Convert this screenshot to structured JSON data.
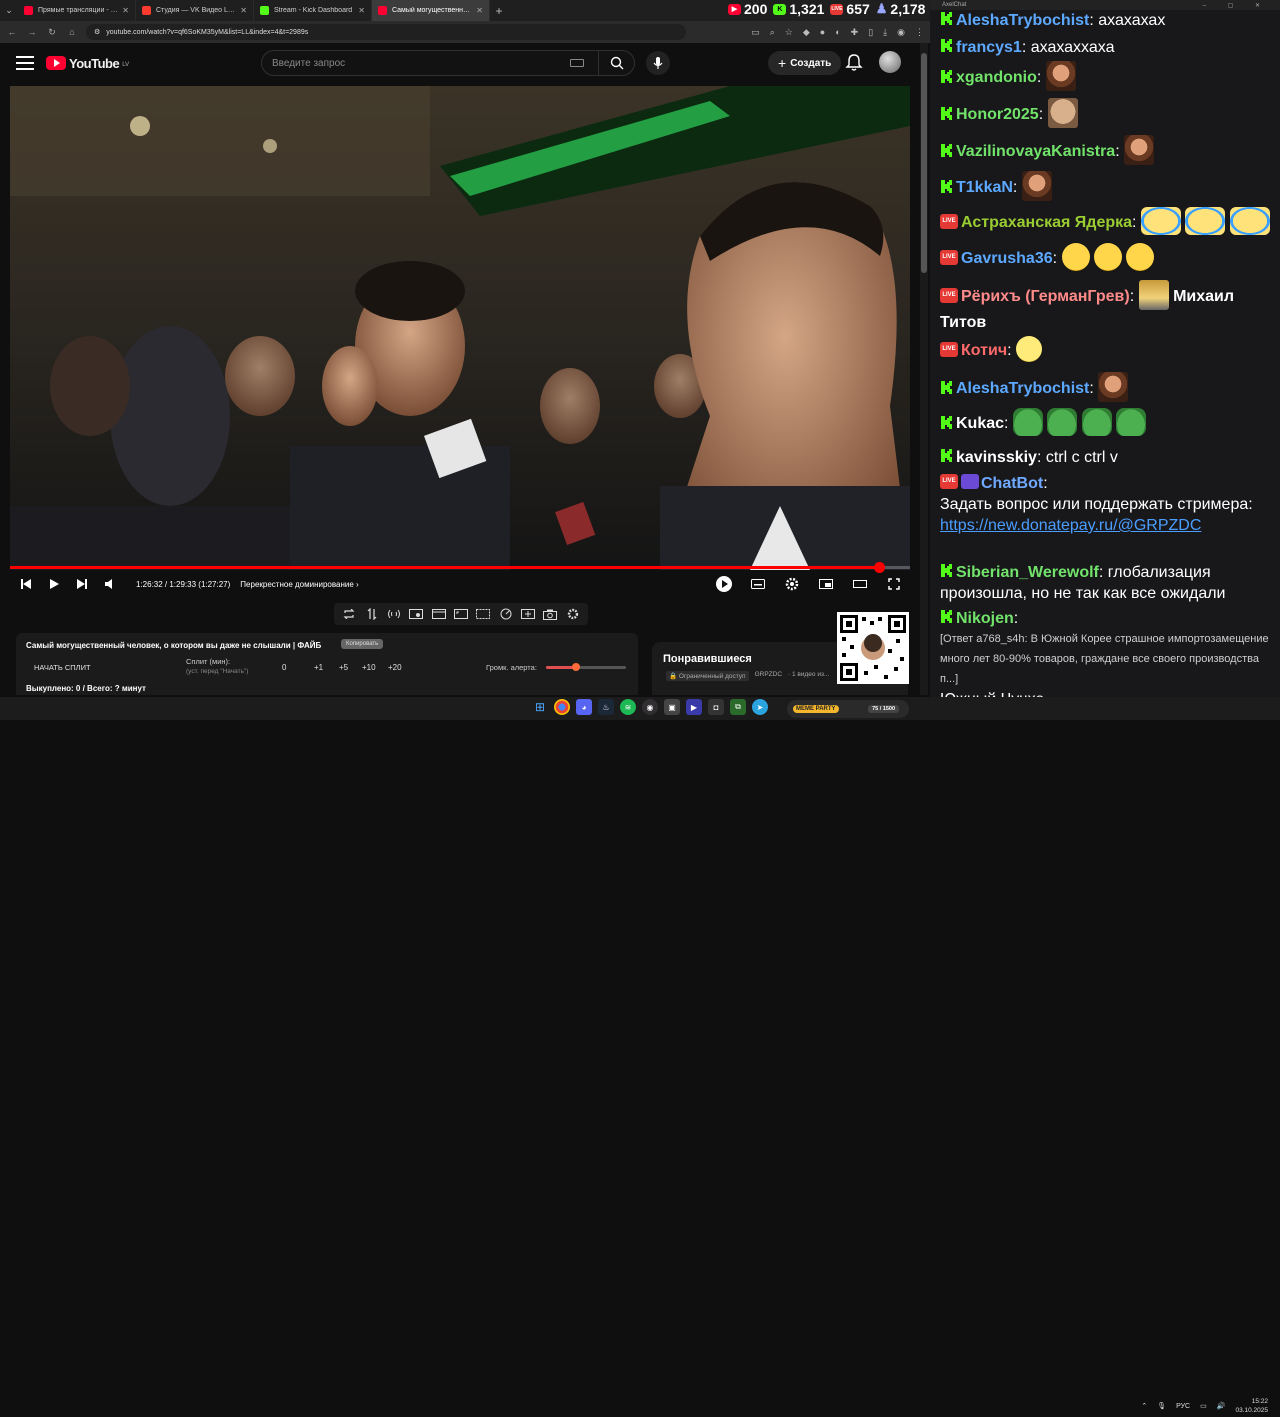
{
  "browser": {
    "tabs": [
      {
        "label": "Прямые трансляции - YouTub...",
        "color": "#ff0033",
        "active": false
      },
      {
        "label": "Студия — VK Видео Live",
        "color": "#ff3b30",
        "active": false
      },
      {
        "label": "Stream - Kick Dashboard",
        "color": "#53fc18",
        "active": false
      },
      {
        "label": "Самый могущественный чел...",
        "color": "#ff0033",
        "active": true
      }
    ],
    "url": "youtube.com/watch?v=qf6SoKM35yM&list=LL&index=4&t=2989s"
  },
  "counters": [
    {
      "platform": "youtube",
      "value": "200",
      "color": "#ff0033"
    },
    {
      "platform": "kick",
      "value": "1,321",
      "color": "#53fc18"
    },
    {
      "platform": "vk-live",
      "value": "657",
      "color": "#e53935"
    },
    {
      "platform": "total",
      "value": "2,178",
      "color": "#9aa7ff"
    }
  ],
  "youtube": {
    "logo_text": "YouTube",
    "logo_region": "LV",
    "search_placeholder": "Введите запрос",
    "create_label": "Создать"
  },
  "player": {
    "progress_fraction": 0.966,
    "time_text": "1:26:32 / 1:29:33 (1:27:27)",
    "chapter": "Перекрестное доминирование"
  },
  "split_panel": {
    "title": "Самый могущественный человек, о котором вы даже не слышали | ФАЙБ",
    "badge": "Копировать",
    "start_label": "НАЧАТЬ СПЛИТ",
    "split_label": "Сплит (мин):",
    "split_hint": "(уст. перед \"Начать\")",
    "split_value": "0",
    "steps": [
      "+1",
      "+5",
      "+10",
      "+20"
    ],
    "volume_label": "Громк. алерта:",
    "volume_fraction": 0.38,
    "bought": "Выкуплено: 0 / Всего: ? минут"
  },
  "liked": {
    "title": "Понравившиеся",
    "restricted": "Ограниченный доступ",
    "channel": "GRPZDC",
    "meta": "· 1 видео из..."
  },
  "chat": {
    "window_title": "AxelChat",
    "messages": [
      {
        "platform": "kick",
        "user": "AleshaTrybochist",
        "color": "#5da9ff",
        "text": "ахахахах",
        "emotes": []
      },
      {
        "platform": "kick",
        "user": "francys1",
        "color": "#5da9ff",
        "text": "ахахаххаха",
        "emotes": []
      },
      {
        "platform": "kick",
        "user": "xgandonio",
        "color": "#72e36a",
        "text": "",
        "emotes": [
          "face"
        ]
      },
      {
        "platform": "kick",
        "user": "Honor2025",
        "color": "#72e36a",
        "text": "",
        "emotes": [
          "honor"
        ]
      },
      {
        "platform": "kick",
        "user": "VazilinovayaKanistra",
        "color": "#72e36a",
        "text": "",
        "emotes": [
          "face"
        ]
      },
      {
        "platform": "kick",
        "user": "T1kkaN",
        "color": "#5da9ff",
        "text": "",
        "emotes": [
          "face"
        ]
      },
      {
        "platform": "vk",
        "user": "Астраханская Ядерка",
        "color": "#9acd32",
        "text": "",
        "emotes": [
          "cry",
          "cry",
          "cry"
        ]
      },
      {
        "platform": "vk",
        "user": "Gavrusha36",
        "color": "#5da9ff",
        "text": "",
        "emotes": [
          "laugh",
          "laugh",
          "laugh"
        ]
      },
      {
        "platform": "vk",
        "user": "Рёрихъ (ГерманГрев)",
        "color": "#ff8a8a",
        "text": "Михаил Титов",
        "emotes": [
          "fig"
        ]
      },
      {
        "platform": "vk",
        "user": "Котич",
        "color": "#ff6a6a",
        "text": "",
        "emotes": [
          "smile"
        ]
      },
      {
        "platform": "kick",
        "user": "AleshaTrybochist",
        "color": "#5da9ff",
        "text": "",
        "emotes": [
          "face"
        ]
      },
      {
        "platform": "kick",
        "user": "Kukac",
        "color": "#ffffff",
        "text": "",
        "emotes": [
          "frog",
          "frog",
          "frog",
          "frog"
        ]
      },
      {
        "platform": "kick",
        "user": "kavinsskiy",
        "color": "#ffffff",
        "text": "ctrl c ctrl v",
        "emotes": []
      },
      {
        "platform": "vk",
        "user": "ChatBot",
        "color": "#6fa8ff",
        "text": "Задать вопрос или поддержать стримера:",
        "link": "https://new.donatepay.ru/@GRPZDC",
        "emotes": []
      },
      {
        "platform": "kick",
        "user": "Siberian_Werewolf",
        "color": "#72e36a",
        "text": "глобализация произошла, но не так как все ожидали",
        "emotes": []
      },
      {
        "platform": "kick",
        "user": "Nikojen",
        "color": "#72e36a",
        "text": "[Ответ a768_s4h: В Южной Корее страшное импортозамещение много лет 80-90% товаров, граждане все своего производства п...]",
        "text2": "Южный Чучхе",
        "emotes": []
      }
    ]
  },
  "taskbar": {
    "meme_label": "MEME PARTY",
    "meme_count": "75 / 1500",
    "lang": "РУС",
    "time": "15:22",
    "date": "03.10.2025"
  }
}
